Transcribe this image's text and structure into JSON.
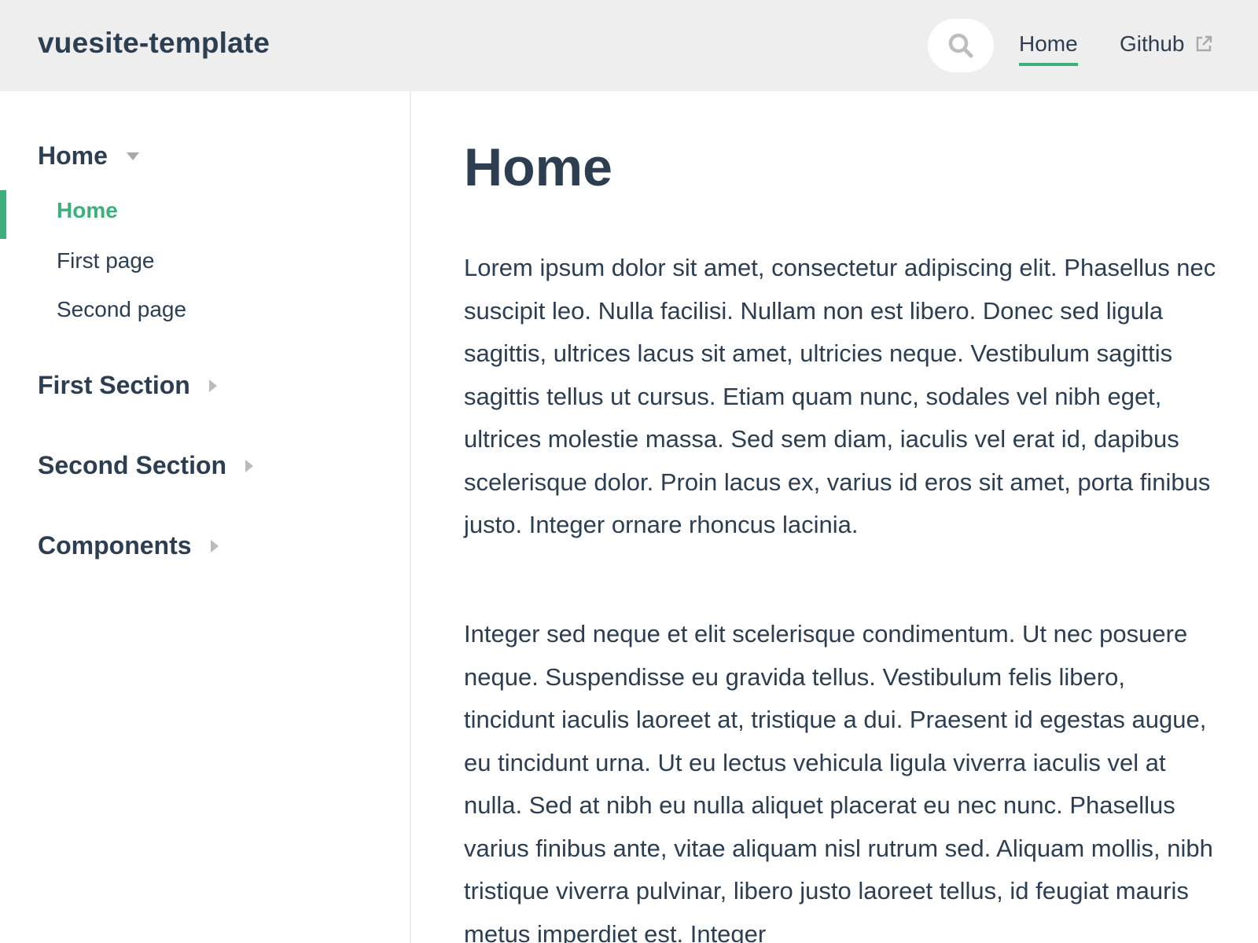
{
  "navbar": {
    "site_title": "vuesite-template",
    "links": [
      {
        "label": "Home",
        "active": true
      },
      {
        "label": "Github",
        "external": true
      }
    ],
    "search_icon": "search-icon",
    "external_icon": "external-link-icon"
  },
  "sidebar": {
    "groups": [
      {
        "title": "Home",
        "expanded": true,
        "items": [
          {
            "label": "Home",
            "active": true
          },
          {
            "label": "First page"
          },
          {
            "label": "Second page"
          }
        ]
      },
      {
        "title": "First Section",
        "expanded": false
      },
      {
        "title": "Second Section",
        "expanded": false
      },
      {
        "title": "Components",
        "expanded": false
      }
    ]
  },
  "main": {
    "title": "Home",
    "paragraphs": [
      "Lorem ipsum dolor sit amet, consectetur adipiscing elit. Phasellus nec suscipit leo. Nulla facilisi. Nullam non est libero. Donec sed ligula sagittis, ultrices lacus sit amet, ultricies neque. Vestibulum sagittis sagittis tellus ut cursus. Etiam quam nunc, sodales vel nibh eget, ultrices molestie massa. Sed sem diam, iaculis vel erat id, dapibus scelerisque dolor. Proin lacus ex, varius id eros sit amet, porta finibus justo. Integer ornare rhoncus lacinia.",
      "Integer sed neque et elit scelerisque condimentum. Ut nec posuere neque. Suspendisse eu gravida tellus. Vestibulum felis libero, tincidunt iaculis laoreet at, tristique a dui. Praesent id egestas augue, eu tincidunt urna. Ut eu lectus vehicula ligula viverra iaculis vel at nulla. Sed at nibh eu nulla aliquet placerat eu nec nunc. Phasellus varius finibus ante, vitae aliquam nisl rutrum sed. Aliquam mollis, nibh tristique viverra pulvinar, libero justo laoreet tellus, id feugiat mauris metus imperdiet est. Integer"
    ]
  },
  "colors": {
    "accent": "#3eaf7c",
    "text": "#2c3e50",
    "navbar_bg": "#eeeeee"
  }
}
